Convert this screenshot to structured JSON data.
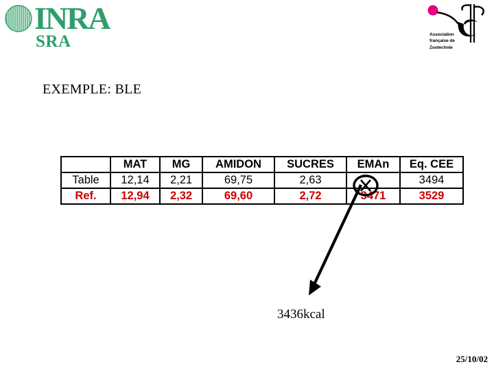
{
  "slide": {
    "title": "EXEMPLE: BLE",
    "date": "25/10/02"
  },
  "logos": {
    "inra": {
      "wordmark": "INRA",
      "subtitle": "SRA",
      "color": "#2e9e6b",
      "emblem_icon": "hatched-circle-icon"
    },
    "afz": {
      "caption_line1": "Association",
      "caption_line2": "française de",
      "caption_line3": "Zootechnie",
      "graphic_icon": "zootechnie-emblem-icon",
      "accent_color": "#e6007e"
    }
  },
  "table": {
    "corner_label": "",
    "columns": [
      "MAT",
      "MG",
      "AMIDON",
      "SUCRES",
      "EMAn",
      "Eq. CEE"
    ],
    "rows": [
      {
        "label": "Table",
        "color": "#000000",
        "values": [
          "12,14",
          "2,21",
          "69,75",
          "2,63",
          "",
          "3494"
        ]
      },
      {
        "label": "Ref.",
        "color": "#cc0000",
        "values": [
          "12,94",
          "2,32",
          "69,60",
          "2,72",
          "3471",
          "3529"
        ]
      }
    ]
  },
  "annotations": {
    "circled_mark": "X",
    "circled_mark_icon": "circled-x-annotation-icon",
    "arrow_icon": "callout-arrow-icon",
    "callout_text": "3436kcal"
  }
}
